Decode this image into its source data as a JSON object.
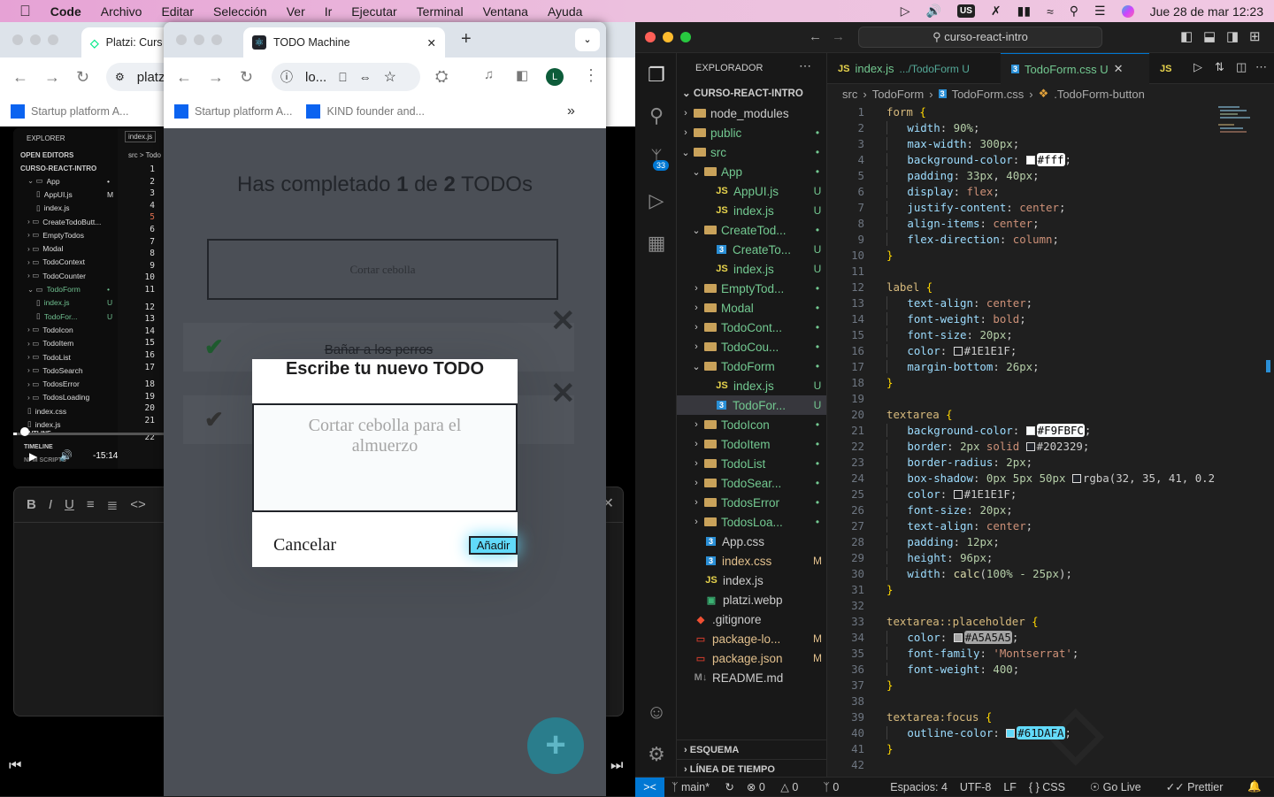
{
  "menubar": {
    "app": "Code",
    "items": [
      "Archivo",
      "Editar",
      "Selección",
      "Ver",
      "Ir",
      "Ejecutar",
      "Terminal",
      "Ventana",
      "Ayuda"
    ],
    "keyboard": "US",
    "datetime": "Jue 28 de mar  12:23"
  },
  "back_browser": {
    "tab_title": "Platzi: Curs",
    "url": "platz",
    "bookmarks": [
      "Startup platform A..."
    ],
    "video": {
      "explorer_title": "EXPLORER",
      "open_editors": "OPEN EDITORS",
      "root": "CURSO-REACT-INTRO",
      "tab": "index.js",
      "crumb": "src > Todo",
      "tree": [
        {
          "n": "App",
          "l": 1,
          "f": true,
          "o": true,
          "b": "•"
        },
        {
          "n": "AppUI.js",
          "l": 2,
          "b": "M"
        },
        {
          "n": "index.js",
          "l": 2
        },
        {
          "n": "CreateTodoButt...",
          "l": 1,
          "f": true
        },
        {
          "n": "EmptyTodos",
          "l": 1,
          "f": true
        },
        {
          "n": "Modal",
          "l": 1,
          "f": true
        },
        {
          "n": "TodoContext",
          "l": 1,
          "f": true
        },
        {
          "n": "TodoCounter",
          "l": 1,
          "f": true
        },
        {
          "n": "TodoForm",
          "l": 1,
          "f": true,
          "o": true,
          "b": "•",
          "g": true
        },
        {
          "n": "index.js",
          "l": 2,
          "b": "U",
          "g": true
        },
        {
          "n": "TodoFor...",
          "l": 2,
          "b": "U",
          "g": true
        },
        {
          "n": "TodoIcon",
          "l": 1,
          "f": true
        },
        {
          "n": "TodoItem",
          "l": 1,
          "f": true
        },
        {
          "n": "TodoList",
          "l": 1,
          "f": true
        },
        {
          "n": "TodoSearch",
          "l": 1,
          "f": true
        },
        {
          "n": "TodosError",
          "l": 1,
          "f": true
        },
        {
          "n": "TodosLoading",
          "l": 1,
          "f": true
        },
        {
          "n": "index.css",
          "l": 1
        },
        {
          "n": "index.js",
          "l": 1
        }
      ],
      "line_numbers": [
        "1",
        "2",
        "3",
        "4",
        "5",
        "6",
        "7",
        "8",
        "9",
        "10",
        "11",
        "12",
        "13",
        "14",
        "15",
        "16",
        "17",
        "18",
        "19",
        "20",
        "21",
        "22"
      ],
      "outline": "OUTLINE",
      "timeline": "TIMELINE",
      "npm": "NPM SCRIPTS",
      "time_remaining": "-15:14",
      "progress": 0.02
    }
  },
  "front_browser": {
    "tab_title": "TODO Machine",
    "url": "lo...",
    "avatar": "L",
    "bookmarks": [
      "Startup platform A...",
      "KIND founder and..."
    ],
    "more": "»"
  },
  "todo_app": {
    "counter_prefix": "Has completado ",
    "completed": "1",
    "counter_mid": " de ",
    "total": "2",
    "counter_suffix": " TODOs",
    "search_value": "Cortar cebolla",
    "todos": [
      {
        "text": "Bañar a los perros",
        "completed": true
      },
      {
        "text": "",
        "completed": false
      }
    ],
    "modal": {
      "title": "Escribe tu nuevo TODO",
      "placeholder": "Cortar cebolla para el almuerzo",
      "cancel": "Cancelar",
      "add": "Añadir"
    },
    "fab": "+"
  },
  "vscode": {
    "search": "curso-react-intro",
    "explorer_title": "EXPLORADOR",
    "root": "CURSO-REACT-INTRO",
    "scm_badge": "33",
    "tree": [
      {
        "n": "node_modules",
        "l": 1,
        "t": "folder",
        "c": "#ccc",
        "ch": ">"
      },
      {
        "n": "public",
        "l": 1,
        "t": "folder",
        "c": "#73c991",
        "ch": ">",
        "b": "•"
      },
      {
        "n": "src",
        "l": 1,
        "t": "folder",
        "c": "#73c991",
        "ch": "v",
        "b": "•"
      },
      {
        "n": "App",
        "l": 2,
        "t": "folder",
        "c": "#73c991",
        "ch": "v",
        "b": "•"
      },
      {
        "n": "AppUI.js",
        "l": 3,
        "t": "js",
        "c": "#73c991",
        "b": "U"
      },
      {
        "n": "index.js",
        "l": 3,
        "t": "js",
        "c": "#73c991",
        "b": "U"
      },
      {
        "n": "CreateTod...",
        "l": 2,
        "t": "folder",
        "c": "#73c991",
        "ch": "v",
        "b": "•"
      },
      {
        "n": "CreateTo...",
        "l": 3,
        "t": "css",
        "c": "#73c991",
        "b": "U"
      },
      {
        "n": "index.js",
        "l": 3,
        "t": "js",
        "c": "#73c991",
        "b": "U"
      },
      {
        "n": "EmptyTod...",
        "l": 2,
        "t": "folder",
        "c": "#73c991",
        "ch": ">",
        "b": "•"
      },
      {
        "n": "Modal",
        "l": 2,
        "t": "folder",
        "c": "#73c991",
        "ch": ">",
        "b": "•"
      },
      {
        "n": "TodoCont...",
        "l": 2,
        "t": "folder",
        "c": "#73c991",
        "ch": ">",
        "b": "•"
      },
      {
        "n": "TodoCou...",
        "l": 2,
        "t": "folder",
        "c": "#73c991",
        "ch": ">",
        "b": "•"
      },
      {
        "n": "TodoForm",
        "l": 2,
        "t": "folder",
        "c": "#73c991",
        "ch": "v",
        "b": "•"
      },
      {
        "n": "index.js",
        "l": 3,
        "t": "js",
        "c": "#73c991",
        "b": "U"
      },
      {
        "n": "TodoFor...",
        "l": 3,
        "t": "css",
        "c": "#73c991",
        "b": "U",
        "sel": true
      },
      {
        "n": "TodoIcon",
        "l": 2,
        "t": "folder",
        "c": "#73c991",
        "ch": ">",
        "b": "•"
      },
      {
        "n": "TodoItem",
        "l": 2,
        "t": "folder",
        "c": "#73c991",
        "ch": ">",
        "b": "•"
      },
      {
        "n": "TodoList",
        "l": 2,
        "t": "folder",
        "c": "#73c991",
        "ch": ">",
        "b": "•"
      },
      {
        "n": "TodoSear...",
        "l": 2,
        "t": "folder",
        "c": "#73c991",
        "ch": ">",
        "b": "•"
      },
      {
        "n": "TodosError",
        "l": 2,
        "t": "folder",
        "c": "#73c991",
        "ch": ">",
        "b": "•"
      },
      {
        "n": "TodosLoa...",
        "l": 2,
        "t": "folder",
        "c": "#73c991",
        "ch": ">",
        "b": "•"
      },
      {
        "n": "App.css",
        "l": 2,
        "t": "css",
        "c": "#ccc"
      },
      {
        "n": "index.css",
        "l": 2,
        "t": "css",
        "c": "#e2c08d",
        "b": "M"
      },
      {
        "n": "index.js",
        "l": 2,
        "t": "js",
        "c": "#ccc"
      },
      {
        "n": "platzi.webp",
        "l": 2,
        "t": "img",
        "c": "#ccc"
      },
      {
        "n": ".gitignore",
        "l": 1,
        "t": "git",
        "c": "#ccc"
      },
      {
        "n": "package-lo...",
        "l": 1,
        "t": "json",
        "c": "#e2c08d",
        "b": "M"
      },
      {
        "n": "package.json",
        "l": 1,
        "t": "json",
        "c": "#e2c08d",
        "b": "M"
      },
      {
        "n": "README.md",
        "l": 1,
        "t": "md",
        "c": "#ccc"
      }
    ],
    "outline": "ESQUEMA",
    "timeline": "LÍNEA DE TIEMPO",
    "tabs": [
      {
        "icon": "JS",
        "name": "index.js",
        "desc": ".../TodoForm U",
        "active": false
      },
      {
        "icon": "3",
        "name": "TodoForm.css U",
        "active": true
      },
      {
        "icon": "JS",
        "name": "",
        "active": false
      }
    ],
    "breadcrumb": [
      "src",
      "TodoForm",
      "TodoForm.css",
      ".TodoForm-button"
    ],
    "code": [
      [
        [
          "t-sel",
          "form "
        ],
        [
          "t-br",
          "{"
        ]
      ],
      [
        [
          "t-prop",
          "    width"
        ],
        [
          "t-p",
          ": "
        ],
        [
          "t-num",
          "90%"
        ],
        [
          "t-p",
          ";"
        ]
      ],
      [
        [
          "t-prop",
          "    max-width"
        ],
        [
          "t-p",
          ": "
        ],
        [
          "t-num",
          "300px"
        ],
        [
          "t-p",
          ";"
        ]
      ],
      [
        [
          "t-prop",
          "    background-color"
        ],
        [
          "t-p",
          ": "
        ],
        [
          "sw",
          "#ffffff"
        ],
        [
          "hl:#ffffff:#000",
          "#fff"
        ],
        [
          "t-p",
          ";"
        ]
      ],
      [
        [
          "t-prop",
          "    padding"
        ],
        [
          "t-p",
          ": "
        ],
        [
          "t-num",
          "33px"
        ],
        [
          "t-p",
          ", "
        ],
        [
          "t-num",
          "40px"
        ],
        [
          "t-p",
          ";"
        ]
      ],
      [
        [
          "t-prop",
          "    display"
        ],
        [
          "t-p",
          ": "
        ],
        [
          "t-str",
          "flex"
        ],
        [
          "t-p",
          ";"
        ]
      ],
      [
        [
          "t-prop",
          "    justify-content"
        ],
        [
          "t-p",
          ": "
        ],
        [
          "t-str",
          "center"
        ],
        [
          "t-p",
          ";"
        ]
      ],
      [
        [
          "t-prop",
          "    align-items"
        ],
        [
          "t-p",
          ": "
        ],
        [
          "t-str",
          "center"
        ],
        [
          "t-p",
          ";"
        ]
      ],
      [
        [
          "t-prop",
          "    flex-direction"
        ],
        [
          "t-p",
          ": "
        ],
        [
          "t-str",
          "column"
        ],
        [
          "t-p",
          ";"
        ]
      ],
      [
        [
          "t-br",
          "}"
        ]
      ],
      [],
      [
        [
          "t-sel",
          "label "
        ],
        [
          "t-br",
          "{"
        ]
      ],
      [
        [
          "t-prop",
          "    text-align"
        ],
        [
          "t-p",
          ": "
        ],
        [
          "t-str",
          "center"
        ],
        [
          "t-p",
          ";"
        ]
      ],
      [
        [
          "t-prop",
          "    font-weight"
        ],
        [
          "t-p",
          ": "
        ],
        [
          "t-str",
          "bold"
        ],
        [
          "t-p",
          ";"
        ]
      ],
      [
        [
          "t-prop",
          "    font-size"
        ],
        [
          "t-p",
          ": "
        ],
        [
          "t-num",
          "20px"
        ],
        [
          "t-p",
          ";"
        ]
      ],
      [
        [
          "t-prop",
          "    color"
        ],
        [
          "t-p",
          ": "
        ],
        [
          "sw",
          "#1E1E1F"
        ],
        [
          "t-p",
          "#1E1E1F;"
        ]
      ],
      [
        [
          "t-prop",
          "    margin-bottom"
        ],
        [
          "t-p",
          ": "
        ],
        [
          "t-num",
          "26px"
        ],
        [
          "t-p",
          ";"
        ]
      ],
      [
        [
          "t-br",
          "}"
        ]
      ],
      [],
      [
        [
          "t-sel",
          "textarea "
        ],
        [
          "t-br",
          "{"
        ]
      ],
      [
        [
          "t-prop",
          "    background-color"
        ],
        [
          "t-p",
          ": "
        ],
        [
          "sw",
          "#F9FBFC"
        ],
        [
          "hl:#F9FBFC:#000",
          "#F9FBFC"
        ],
        [
          "t-p",
          ";"
        ]
      ],
      [
        [
          "t-prop",
          "    border"
        ],
        [
          "t-p",
          ": "
        ],
        [
          "t-num",
          "2px "
        ],
        [
          "t-str",
          "solid "
        ],
        [
          "sw",
          "#202329"
        ],
        [
          "t-p",
          "#202329;"
        ]
      ],
      [
        [
          "t-prop",
          "    border-radius"
        ],
        [
          "t-p",
          ": "
        ],
        [
          "t-num",
          "2px"
        ],
        [
          "t-p",
          ";"
        ]
      ],
      [
        [
          "t-prop",
          "    box-shadow"
        ],
        [
          "t-p",
          ": "
        ],
        [
          "t-num",
          "0px 5px 50px "
        ],
        [
          "sw",
          "#202329"
        ],
        [
          "t-p",
          "rgba(32, 35, 41, 0.2"
        ]
      ],
      [
        [
          "t-prop",
          "    color"
        ],
        [
          "t-p",
          ": "
        ],
        [
          "sw",
          "#1E1E1F"
        ],
        [
          "t-p",
          "#1E1E1F;"
        ]
      ],
      [
        [
          "t-prop",
          "    font-size"
        ],
        [
          "t-p",
          ": "
        ],
        [
          "t-num",
          "20px"
        ],
        [
          "t-p",
          ";"
        ]
      ],
      [
        [
          "t-prop",
          "    text-align"
        ],
        [
          "t-p",
          ": "
        ],
        [
          "t-str",
          "center"
        ],
        [
          "t-p",
          ";"
        ]
      ],
      [
        [
          "t-prop",
          "    padding"
        ],
        [
          "t-p",
          ": "
        ],
        [
          "t-num",
          "12px"
        ],
        [
          "t-p",
          ";"
        ]
      ],
      [
        [
          "t-prop",
          "    height"
        ],
        [
          "t-p",
          ": "
        ],
        [
          "t-num",
          "96px"
        ],
        [
          "t-p",
          ";"
        ]
      ],
      [
        [
          "t-prop",
          "    width"
        ],
        [
          "t-p",
          ": "
        ],
        [
          "t-fn",
          "calc"
        ],
        [
          "t-p",
          "("
        ],
        [
          "t-num",
          "100% - 25px"
        ],
        [
          "t-p",
          ");"
        ]
      ],
      [
        [
          "t-br",
          "}"
        ]
      ],
      [],
      [
        [
          "t-sel",
          "textarea::placeholder "
        ],
        [
          "t-br",
          "{"
        ]
      ],
      [
        [
          "t-prop",
          "    color"
        ],
        [
          "t-p",
          ": "
        ],
        [
          "sw",
          "#A5A5A5"
        ],
        [
          "hl:#A5A5A5:#111",
          "#A5A5A5"
        ],
        [
          "t-p",
          ";"
        ]
      ],
      [
        [
          "t-prop",
          "    font-family"
        ],
        [
          "t-p",
          ": "
        ],
        [
          "t-str",
          "'Montserrat'"
        ],
        [
          "t-p",
          ";"
        ]
      ],
      [
        [
          "t-prop",
          "    font-weight"
        ],
        [
          "t-p",
          ": "
        ],
        [
          "t-num",
          "400"
        ],
        [
          "t-p",
          ";"
        ]
      ],
      [
        [
          "t-br",
          "}"
        ]
      ],
      [],
      [
        [
          "t-sel",
          "textarea:focus "
        ],
        [
          "t-br",
          "{"
        ]
      ],
      [
        [
          "t-prop",
          "    outline-color"
        ],
        [
          "t-p",
          ": "
        ],
        [
          "sw",
          "#61DAFA"
        ],
        [
          "hl:#61DAFA:#111",
          "#61DAFA"
        ],
        [
          "t-p",
          ";"
        ]
      ],
      [
        [
          "t-br",
          "}"
        ]
      ],
      []
    ],
    "status": {
      "branch": "main*",
      "errors": "0",
      "warnings": "0",
      "ports": "0",
      "spaces": "Espacios: 4",
      "encoding": "UTF-8",
      "eol": "LF",
      "language": "CSS",
      "golive": "Go Live",
      "prettier": "Prettier"
    }
  },
  "colors": {
    "accent": "#61DAFA",
    "vscode_bg": "#1f1f1f",
    "statusbar_remote": "#0078d4"
  }
}
